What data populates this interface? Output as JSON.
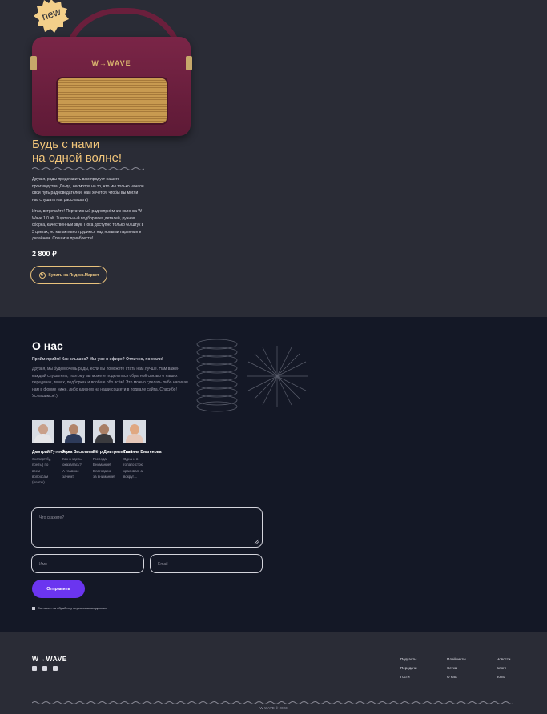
{
  "product": {
    "badge": "new",
    "radio_logo": "W→WAVE",
    "title_line1": "Будь с нами",
    "title_line2": "на одной волне!",
    "paragraph1": "Друзья, рады представить вам продукт нашего производства! Да-да, несмотря на то, что мы только начали свой путь радиоведателей, нам хочется, чтобы вы могли нас слушать нас расслышать)",
    "paragraph2": "Итак, встречайте! Портативный радиоприёмник-колонка W-Wave 1.0 alt. Тщательный подбор всех деталей, ручная сборка, качественный звук. Пока доступно только 60 штук в 3 цветах, но мы активно трудимся над новыми партиями и дизайном. Спешите приобрести!",
    "price": "2 800 ₽",
    "buy_label": "Купить на Яндекс.Маркет",
    "buy_icon": "refresh-icon"
  },
  "about": {
    "title": "О нас",
    "lead": "Прийм-прийм! Как слышно? Мы уже в эфире? Отлично, поехали!",
    "text": "Друзья, мы будем очень рады, если вы поможете стать нам лучше. Нам важен каждый слушатель, поэтому вы можете поделиться обратной связью о наших передачах, темах, подборках и вообще обо всём! Это можно сделать либо написав нам в форме ниже, либо кликнув на наши соцсети в подвале сайта. Спасибо! Услышимся!:)",
    "people": [
      {
        "name": "Дмитрий Гутенберг",
        "quote": "Эксперт бу, понты) по всем вопросам (понты)"
      },
      {
        "name": "Анна Васильева",
        "quote": "Как в здесь оказалась? А главное — зачем?"
      },
      {
        "name": "Пётр Дмитриевский",
        "quote": "Господа! Внимание! Благодарю за внимание!"
      },
      {
        "name": "Татьяна Виагенова",
        "quote": "Одна и в голато стою красивая, а вокруг…"
      }
    ],
    "form": {
      "message_placeholder": "Что скажете?",
      "name_placeholder": "Имя",
      "email_placeholder": "Email",
      "submit_label": "Отправить",
      "consent_label": "Согласен на обработку персональных данных"
    }
  },
  "footer": {
    "logo": "W→WAVE",
    "socials": [
      "vk-icon",
      "telegram-icon",
      "youtube-icon"
    ],
    "col1": [
      "Подкасты",
      "Передачи",
      "Гости"
    ],
    "col2": [
      "Плейлисты",
      "Сетка",
      "О нас"
    ],
    "col3": [
      "Новости",
      "Блоги",
      "Топы"
    ],
    "copyright": "W-WAVE © 2023"
  },
  "colors": {
    "page_bg": "#2a2c36",
    "about_bg": "#141826",
    "accent_gold": "#f1c57a",
    "accent_purple": "#6b35f0"
  }
}
